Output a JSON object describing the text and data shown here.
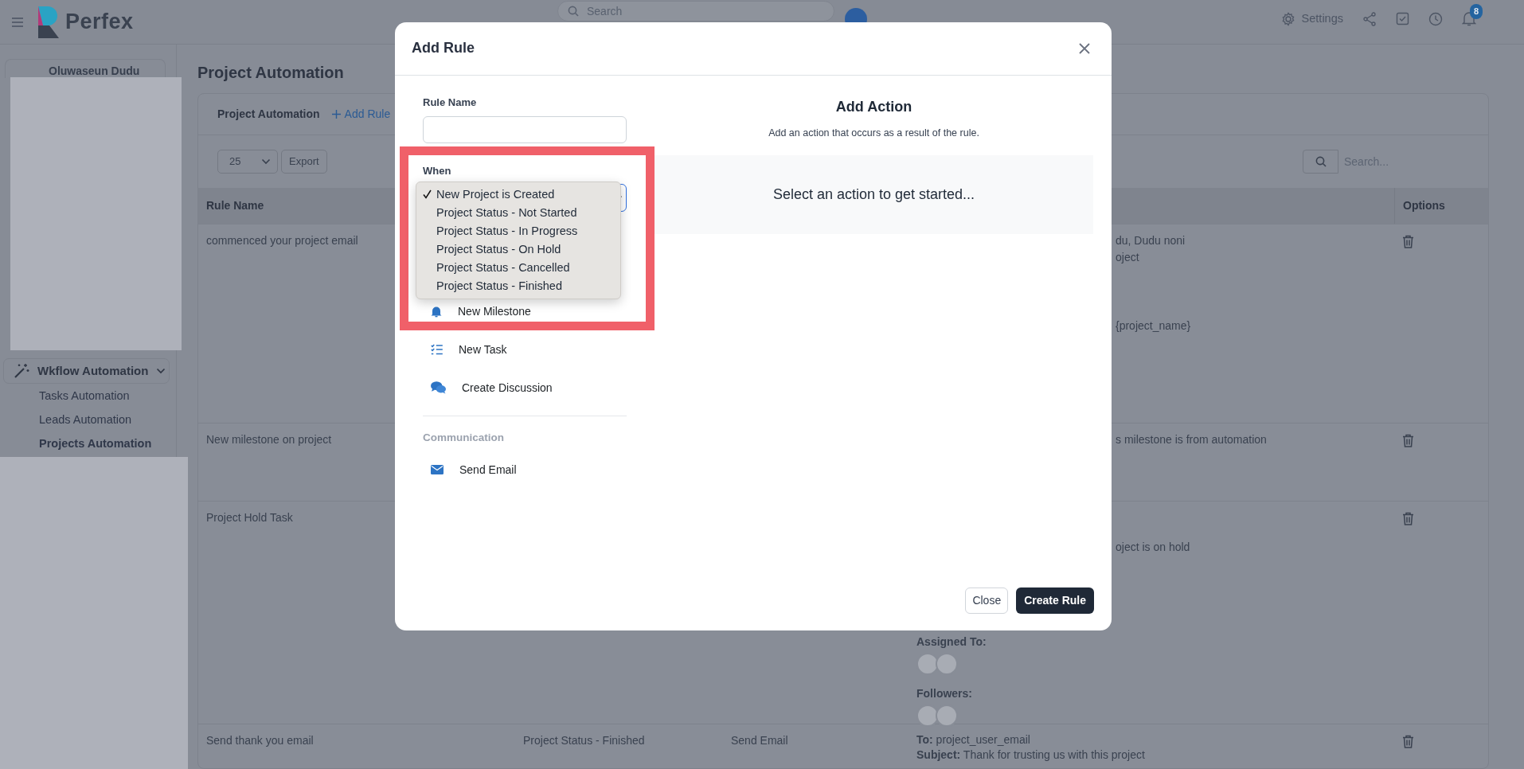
{
  "topbar": {
    "logo": "Perfex",
    "search_placeholder": "Search",
    "settings_label": "Settings",
    "notification_count": "8"
  },
  "sidebar": {
    "user_name": "Oluwaseun Dudu",
    "menu": [
      {
        "label": "Wkflow Automation",
        "expanded": true,
        "children": [
          {
            "label": "Tasks Automation",
            "selected": false
          },
          {
            "label": "Leads Automation",
            "selected": false
          },
          {
            "label": "Projects Automation",
            "selected": true
          }
        ]
      }
    ]
  },
  "page_title": "Project Automation",
  "card": {
    "title": "Project Automation",
    "add_link": "Add Rule",
    "page_size": "25",
    "export_button": "Export",
    "search_placeholder": "Search...",
    "table": {
      "columns": [
        "Rule Name",
        "Options"
      ],
      "rows": [
        {
          "name": "commenced your project email",
          "details": [
            {
              "kind": "clipped",
              "text": "du, Dudu noni"
            },
            {
              "kind": "clipped",
              "text": "oject"
            },
            {
              "kind": "clipped",
              "text": "{project_name}"
            }
          ]
        },
        {
          "name": "New milestone on project",
          "details": [
            {
              "kind": "clipped",
              "text": "s milestone is from automation"
            }
          ]
        },
        {
          "name": "Project Hold Task",
          "details": [
            {
              "kind": "clipped",
              "text": "oject is on hold"
            },
            {
              "kind": "label",
              "text": "Assigned To:"
            },
            {
              "kind": "avatars"
            },
            {
              "kind": "label",
              "text": "Followers:"
            },
            {
              "kind": "avatars"
            }
          ]
        },
        {
          "name": "Send thank you email",
          "trigger": "Project Status - Finished",
          "action": "Send Email",
          "details": [
            {
              "kind": "text",
              "text": "**To:** project_user_email"
            },
            {
              "kind": "text",
              "text": "**Subject:** Thank for trusting us with this project"
            }
          ]
        }
      ]
    }
  },
  "modal": {
    "title": "Add Rule",
    "rule_name_label": "Rule Name",
    "when_label": "When",
    "when_options": [
      {
        "label": "New Project is Created",
        "selected": true
      },
      {
        "label": "Project Status - Not Started",
        "selected": false
      },
      {
        "label": "Project Status - In Progress",
        "selected": false
      },
      {
        "label": "Project Status - On Hold",
        "selected": false
      },
      {
        "label": "Project Status - Cancelled",
        "selected": false
      },
      {
        "label": "Project Status - Finished",
        "selected": false
      }
    ],
    "action_groups": [
      {
        "items": [
          {
            "kind": "milestone",
            "label": "New Milestone"
          },
          {
            "kind": "task",
            "label": "New Task"
          },
          {
            "kind": "discussion",
            "label": "Create Discussion"
          }
        ]
      },
      {
        "title": "Communication",
        "items": [
          {
            "kind": "email",
            "label": "Send Email"
          }
        ]
      }
    ],
    "add_action": {
      "title": "Add Action",
      "subtitle": "Add an action that occurs as a result of the rule.",
      "empty_text": "Select an action to get started..."
    },
    "buttons": [
      {
        "kind": "secondary",
        "label": "Close"
      },
      {
        "kind": "primary",
        "label": "Create Rule"
      }
    ]
  }
}
